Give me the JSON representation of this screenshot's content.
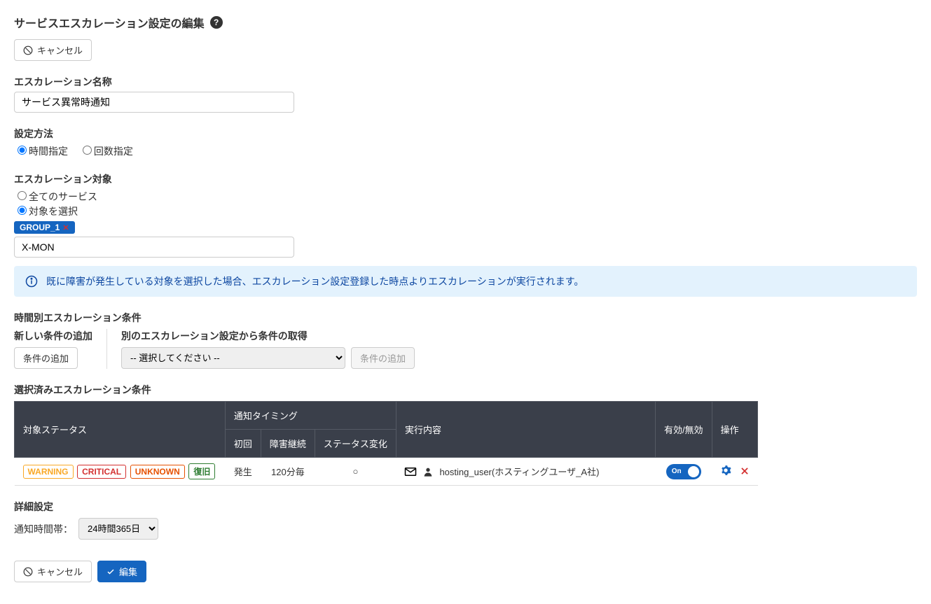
{
  "header": {
    "title": "サービスエスカレーション設定の編集",
    "cancel": "キャンセル"
  },
  "name_section": {
    "label": "エスカレーション名称",
    "value": "サービス異常時通知"
  },
  "method_section": {
    "label": "設定方法",
    "option_time": "時間指定",
    "option_count": "回数指定"
  },
  "target_section": {
    "label": "エスカレーション対象",
    "option_all": "全てのサービス",
    "option_select": "対象を選択",
    "tag": "GROUP_1",
    "input_value": "X-MON"
  },
  "info": {
    "text": "既に障害が発生している対象を選択した場合、エスカレーション設定登録した時点よりエスカレーションが実行されます。"
  },
  "condition": {
    "title": "時間別エスカレーション条件",
    "add_label": "新しい条件の追加",
    "add_button": "条件の追加",
    "import_label": "別のエスカレーション設定から条件の取得",
    "import_select": "-- 選択してください --",
    "import_button": "条件の追加"
  },
  "selected": {
    "title": "選択済みエスカレーション条件",
    "headers": {
      "status": "対象ステータス",
      "timing": "通知タイミング",
      "first": "初回",
      "cont": "障害継続",
      "change": "ステータス変化",
      "exec": "実行内容",
      "enable": "有効/無効",
      "ops": "操作"
    },
    "row": {
      "badges": {
        "warning": "WARNING",
        "critical": "CRITICAL",
        "unknown": "UNKNOWN",
        "recovery": "復旧"
      },
      "first": "発生",
      "cont": "120分毎",
      "change": "○",
      "user": "hosting_user(ホスティングユーザ_A社)",
      "toggle": "On"
    }
  },
  "detail": {
    "title": "詳細設定",
    "notify_label": "通知時間帯：",
    "notify_value": "24時間365日"
  },
  "footer": {
    "cancel": "キャンセル",
    "submit": "編集"
  }
}
